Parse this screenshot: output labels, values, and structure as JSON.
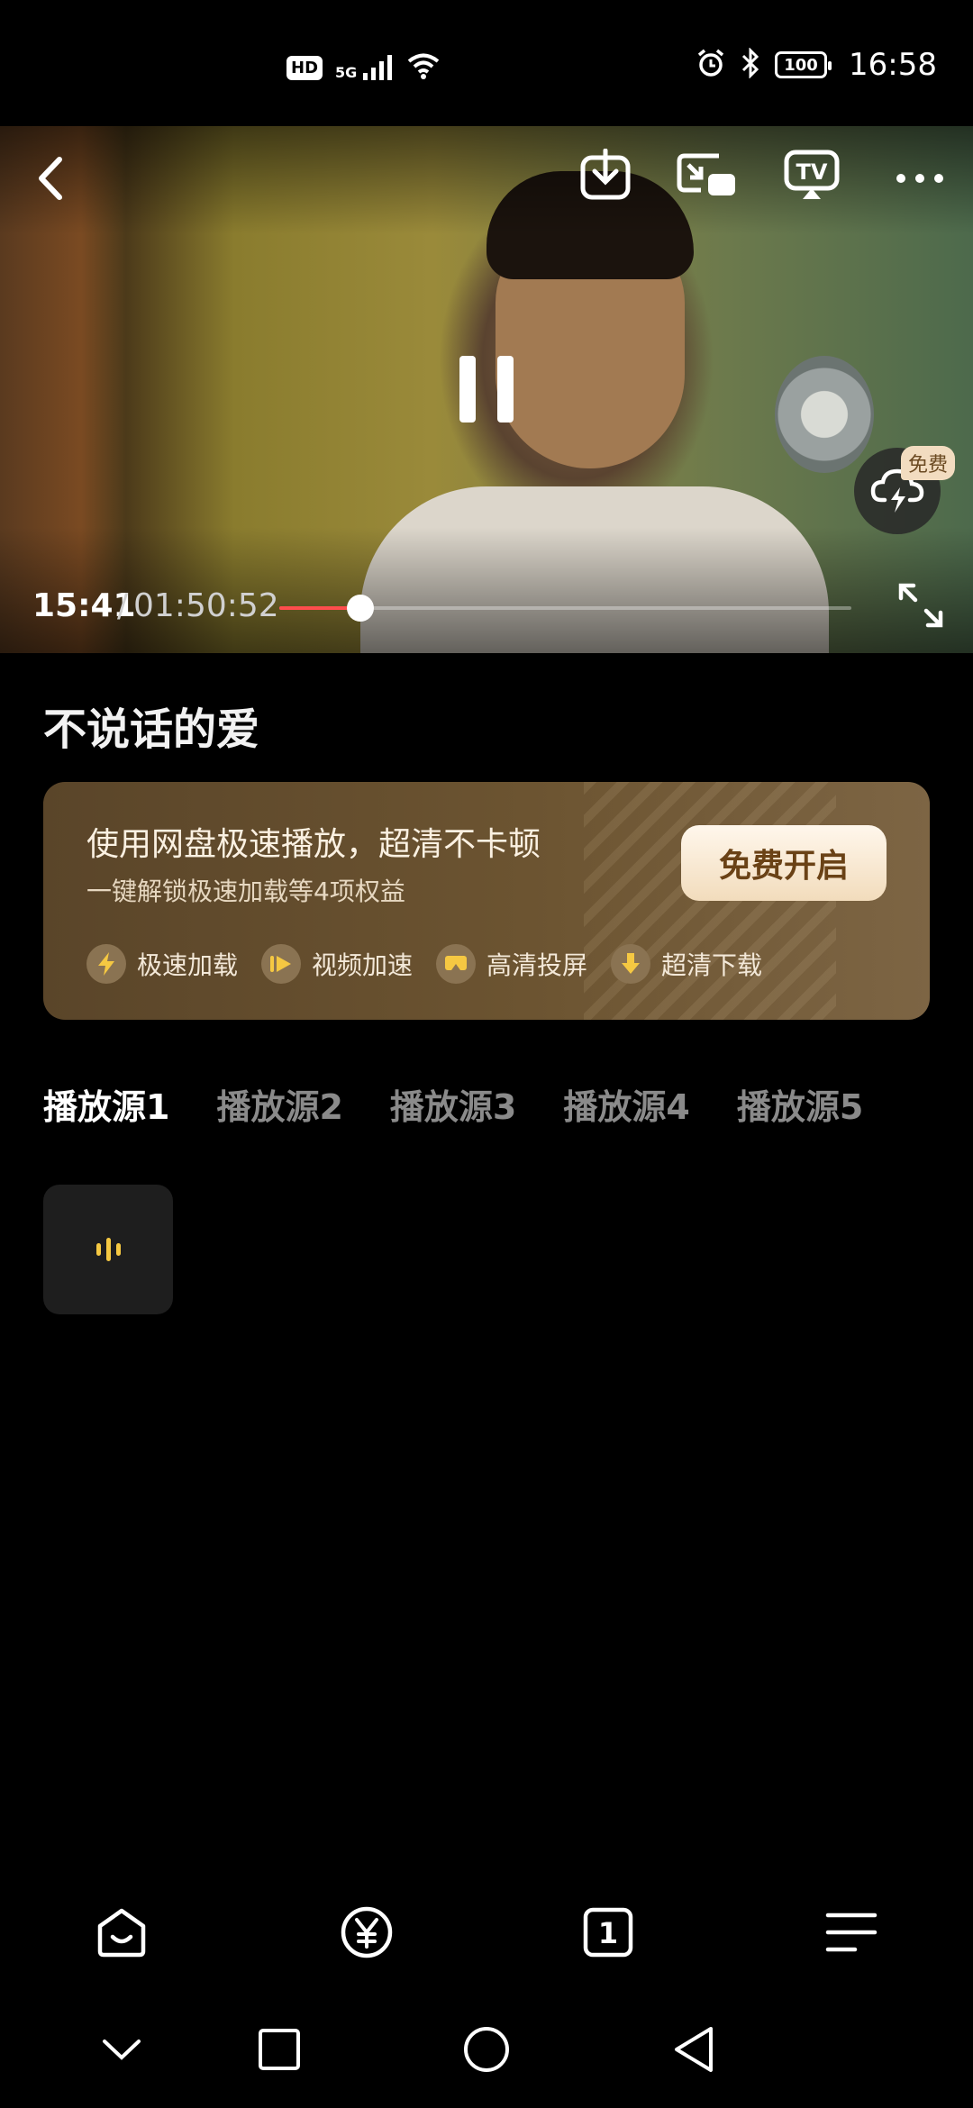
{
  "status_bar": {
    "hd": "HD",
    "network": "5G",
    "battery": "100",
    "time": "16:58"
  },
  "player": {
    "current_time": "15:41",
    "separator": "/",
    "total_time": "01:50:52",
    "progress_fraction": 0.142,
    "free_badge": "免费"
  },
  "movie": {
    "title": "不说话的爱"
  },
  "promo": {
    "title": "使用网盘极速播放，超清不卡顿",
    "subtitle": "一键解锁极速加载等4项权益",
    "button": "免费开启",
    "perks": [
      {
        "label": "极速加载",
        "icon": "lightning-icon"
      },
      {
        "label": "视频加速",
        "icon": "fast-forward-icon"
      },
      {
        "label": "高清投屏",
        "icon": "cast-screen-icon"
      },
      {
        "label": "超清下载",
        "icon": "download-arrow-icon"
      }
    ]
  },
  "sources": {
    "tabs": [
      "播放源1",
      "播放源2",
      "播放源3",
      "播放源4",
      "播放源5"
    ],
    "active_index": 0
  },
  "bottom_nav": {
    "items": [
      "home-icon",
      "yuan-icon",
      "tab-count-icon",
      "menu-icon"
    ],
    "tab_count": "1"
  },
  "colors": {
    "progress": "#ff4d4d",
    "accent_gold": "#f5c842",
    "promo_bg": "#6c5431"
  }
}
